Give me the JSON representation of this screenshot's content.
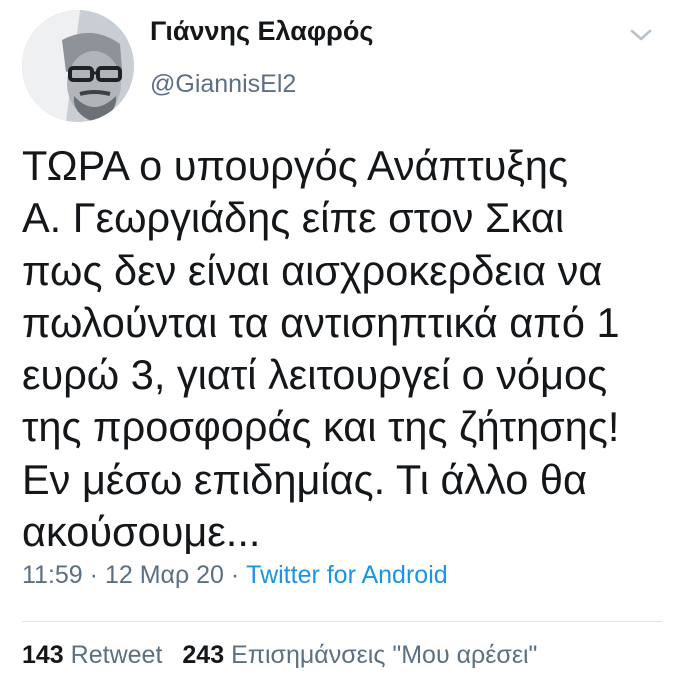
{
  "author": {
    "display_name": "Γιάννης Ελαφρός",
    "handle": "@GiannisEl2"
  },
  "icons": {
    "menu": "chevron-down-icon",
    "avatar": "avatar"
  },
  "tweet": {
    "lines": [
      "ΤΩΡΑ ο υπουργός Ανάπτυξης",
      "Α. Γεωργιάδης είπε στον Σκαι",
      "πως δεν είναι αισχροκερδεια να",
      "πωλούνται τα αντισηπτικά από 1",
      "ευρώ 3, γιατί λειτουργεί ο νόμος",
      "της προσφοράς και της ζήτησης!",
      "Εν μέσω επιδημίας. Τι άλλο θα",
      "ακούσουμε..."
    ]
  },
  "meta": {
    "time": "11:59",
    "sep1": " · ",
    "date": "12 Μαρ 20",
    "sep2": " · ",
    "source": "Twitter for Android"
  },
  "stats": {
    "retweets_count": "143",
    "retweets_label": "Retweet",
    "likes_count": "243",
    "likes_label": "Επισημάνσεις \"Μου αρέσει\""
  },
  "colors": {
    "text": "#14171a",
    "secondary": "#5b7083",
    "link": "#1b95e0",
    "divider": "#dfe3e7"
  }
}
